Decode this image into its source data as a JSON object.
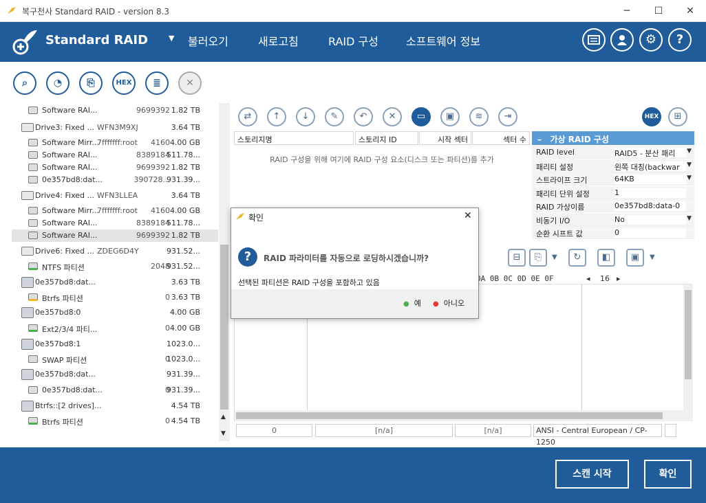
{
  "window": {
    "title": "복구천사 Standard RAID - version 8.3",
    "minimize": "─",
    "maximize": "☐",
    "close": "✕"
  },
  "header": {
    "brand": "Standard RAID",
    "menu": {
      "load": "불러오기",
      "refresh": "새로고침",
      "raid": "RAID 구성",
      "about": "소프트웨어 정보"
    }
  },
  "left_toolbar": {
    "hex": "HEX"
  },
  "tree": [
    {
      "name": "Software RAI...",
      "id": "",
      "n1": "9699392",
      "n2": "1.82 TB",
      "icon": "disk"
    },
    {
      "name": "Drive3: Fixed ...",
      "id": "WFN3M9XJ",
      "n1": "",
      "n2": "3.64 TB",
      "icon": "drive"
    },
    {
      "name": "Software Mirr...",
      "id": "7fffffff:root",
      "n1": "4160",
      "n2": "4.00 GB",
      "icon": "disk"
    },
    {
      "name": "Software RAI...",
      "id": "",
      "n1": "8389184",
      "n2": "511.78...",
      "icon": "disk"
    },
    {
      "name": "Software RAI...",
      "id": "",
      "n1": "9699392",
      "n2": "1.82 TB",
      "icon": "disk"
    },
    {
      "name": "0e357bd8:dat...",
      "id": "",
      "n1": "390728...",
      "n2": "931.39...",
      "icon": "disk"
    },
    {
      "name": "Drive4: Fixed ...",
      "id": "WFN3LLEA",
      "n1": "",
      "n2": "3.64 TB",
      "icon": "drive"
    },
    {
      "name": "Software Mirr...",
      "id": "7fffffff:root",
      "n1": "4160",
      "n2": "4.00 GB",
      "icon": "disk"
    },
    {
      "name": "Software RAI...",
      "id": "",
      "n1": "8389184",
      "n2": "511.78...",
      "icon": "disk"
    },
    {
      "name": "Software RAI...",
      "id": "",
      "n1": "9699392",
      "n2": "1.82 TB",
      "icon": "disk"
    },
    {
      "name": "Drive6: Fixed ...",
      "id": "ZDEG6D4Y",
      "n1": "",
      "n2": "931.52...",
      "icon": "drive"
    },
    {
      "name": "NTFS 파티션",
      "id": "",
      "n1": "2048",
      "n2": "931.52...",
      "icon": "part-green"
    },
    {
      "name": "0e357bd8:dat...",
      "id": "",
      "n1": "",
      "n2": "3.63 TB",
      "icon": "raid"
    },
    {
      "name": "Btrfs 파티션",
      "id": "",
      "n1": "0",
      "n2": "3.63 TB",
      "icon": "part-yellow"
    },
    {
      "name": "0e357bd8:0",
      "id": "",
      "n1": "",
      "n2": "4.00 GB",
      "icon": "raid"
    },
    {
      "name": "Ext2/3/4 파티...",
      "id": "",
      "n1": "0",
      "n2": "4.00 GB",
      "icon": "part-green"
    },
    {
      "name": "0e357bd8:1",
      "id": "",
      "n1": "",
      "n2": "1023.0...",
      "icon": "raid"
    },
    {
      "name": "SWAP 파티션",
      "id": "",
      "n1": "0",
      "n2": "1023.0...",
      "icon": "part-gray"
    },
    {
      "name": "0e357bd8:dat...",
      "id": "",
      "n1": "",
      "n2": "931.39...",
      "icon": "raid"
    },
    {
      "name": "0e357bd8:dat...",
      "id": "",
      "n1": "0",
      "n2": "931.39...",
      "icon": "disk"
    },
    {
      "name": "Btrfs::[2 drives]...",
      "id": "",
      "n1": "",
      "n2": "4.54 TB",
      "icon": "raid"
    },
    {
      "name": "Btrfs 파티션",
      "id": "",
      "n1": "0",
      "n2": "4.54 TB",
      "icon": "part-green"
    }
  ],
  "right_toolbar": {
    "hex": "HEX"
  },
  "table": {
    "columns": [
      "스토리지명",
      "스토리지 ID",
      "시작 섹터",
      "섹터 수"
    ],
    "hint": "RAID 구성을 위해 여기에 RAID 구성 요소(디스크 또는 파티션)를 추가"
  },
  "props": {
    "title": "가상 RAID 구성",
    "rows": [
      {
        "k": "RAID level",
        "v": "RAID5 - 분산 패리",
        "dd": true
      },
      {
        "k": "패리티 설정",
        "v": "왼쪽 대칭(backwar",
        "dd": true
      },
      {
        "k": "스트라이프 크기",
        "v": "64KB",
        "dd": true
      },
      {
        "k": "패리티 단위 설정",
        "v": "1",
        "dd": false
      },
      {
        "k": "RAID 가상이름",
        "v": "0e357bd8:data-0",
        "dd": false
      },
      {
        "k": "비동기 I/O",
        "v": "No",
        "dd": true
      },
      {
        "k": "순환 시프트 값",
        "v": "0",
        "dd": false
      }
    ]
  },
  "hex": {
    "header": "0A 0B 0C 0D 0E 0F",
    "cols": "16"
  },
  "status": {
    "offset": "0",
    "a": "[n/a]",
    "b": "[n/a]",
    "encoding": "ANSI - Central European / CP-1250"
  },
  "dialog": {
    "title": "확인",
    "question": "RAID 파라미터를 자동으로 로딩하시겠습니까?",
    "info": "선택된 파티션은 RAID 구성을 포함하고 있음",
    "yes": "예",
    "no": "아니오"
  },
  "footer": {
    "scan": "스캔 시작",
    "ok": "확인"
  },
  "colors": {
    "brand": "#1f5c99",
    "accent_dark": "#1a4f85",
    "yes_dot": "#4caf50",
    "no_dot": "#e53935"
  }
}
